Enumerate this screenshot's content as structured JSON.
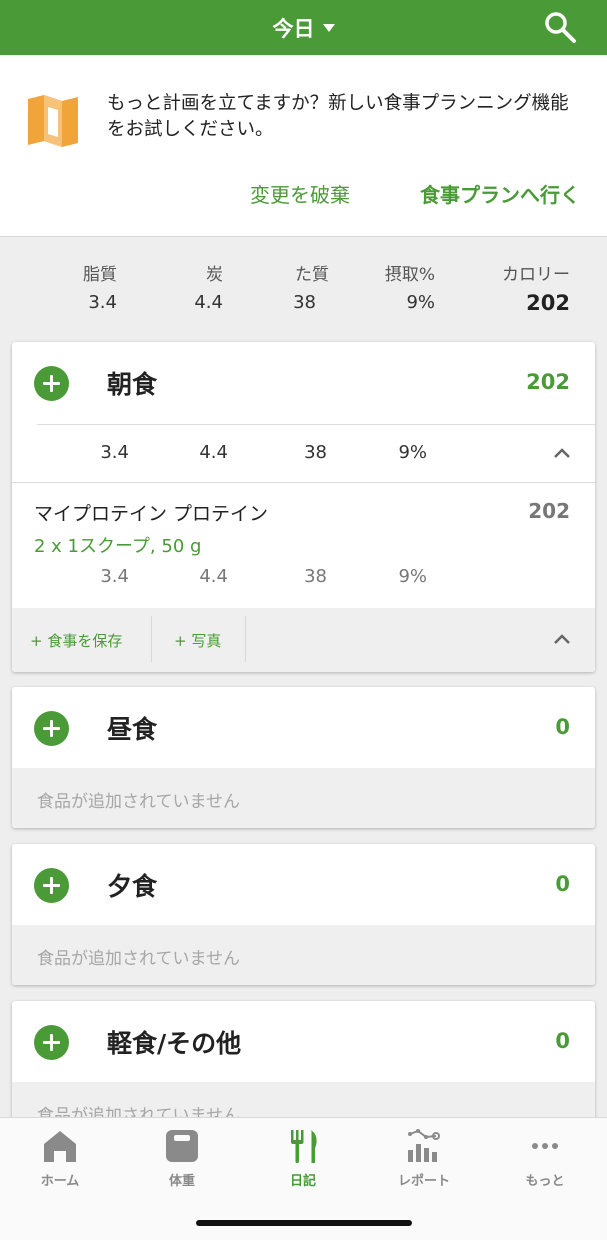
{
  "header": {
    "title": "今日"
  },
  "promo": {
    "message": "もっと計画を立てますか？新しい食事プランニング機能をお試しください。",
    "discard_label": "変更を破棄",
    "go_plan_label": "食事プランへ行く"
  },
  "totals": {
    "headers": {
      "fat": "脂質",
      "carbs": "炭",
      "protein": "た質",
      "intake_pct": "摂取%",
      "calories": "カロリー"
    },
    "values": {
      "fat": "3.4",
      "carbs": "4.4",
      "protein": "38",
      "intake_pct": "9%",
      "calories": "202"
    }
  },
  "meals": [
    {
      "title": "朝食",
      "calories": "202",
      "macros": {
        "fat": "3.4",
        "carbs": "4.4",
        "protein": "38",
        "intake_pct": "9%"
      },
      "foods": [
        {
          "name": "マイプロテイン プロテイン",
          "serving": "2  x 1スクープ, 50 g",
          "calories": "202",
          "macros": {
            "fat": "3.4",
            "carbs": "4.4",
            "protein": "38",
            "intake_pct": "9%"
          }
        }
      ],
      "actions": {
        "save_meal": "+ 食事を保存",
        "photo": "+ 写真"
      }
    },
    {
      "title": "昼食",
      "calories": "0",
      "empty_text": "食品が追加されていません"
    },
    {
      "title": "夕食",
      "calories": "0",
      "empty_text": "食品が追加されていません"
    },
    {
      "title": "軽食/その他",
      "calories": "0",
      "empty_text": "食品が追加されていません"
    }
  ],
  "tabbar": {
    "items": [
      {
        "label": "ホーム",
        "icon": "home-icon"
      },
      {
        "label": "体重",
        "icon": "scale-icon"
      },
      {
        "label": "日記",
        "icon": "fork-knife-icon",
        "active": true
      },
      {
        "label": "レポート",
        "icon": "report-chart-icon"
      },
      {
        "label": "もっと",
        "icon": "more-dots-icon"
      }
    ]
  },
  "colors": {
    "brand_green": "#4a9b37",
    "promo_orange": "#f0a43a"
  }
}
